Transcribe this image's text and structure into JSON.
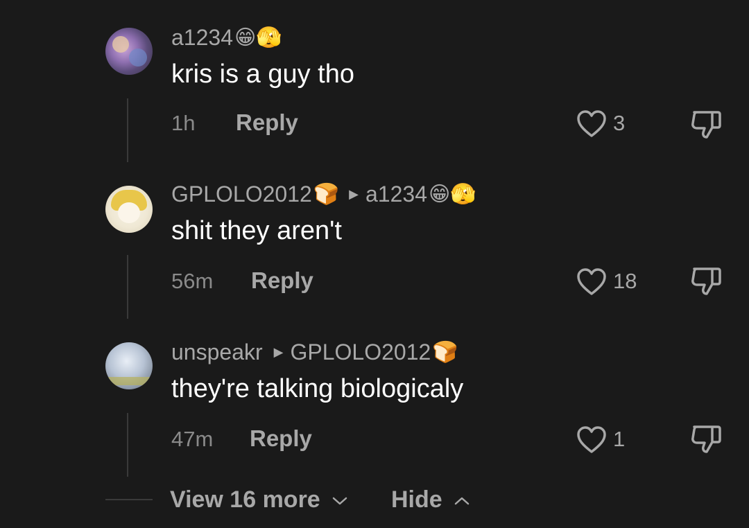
{
  "comments": [
    {
      "author": "a1234",
      "author_emoji": "😁🫣",
      "reply_to": "",
      "reply_to_emoji": "",
      "text": "kris is a guy tho",
      "time": "1h",
      "reply_label": "Reply",
      "likes": "3"
    },
    {
      "author": "GPLOLO2012",
      "author_emoji": "🍞",
      "reply_to": "a1234",
      "reply_to_emoji": "😁🫣",
      "text": "shit they aren't",
      "time": "56m",
      "reply_label": "Reply",
      "likes": "18"
    },
    {
      "author": "unspeakr",
      "author_emoji": "",
      "reply_to": "GPLOLO2012",
      "reply_to_emoji": "🍞",
      "text": "they're talking biologicaly",
      "time": "47m",
      "reply_label": "Reply",
      "likes": "1"
    }
  ],
  "footer": {
    "view_more": "View 16 more",
    "hide": "Hide"
  },
  "icons": {
    "heart": "heart-icon",
    "dislike": "thumbs-down-icon",
    "reply_arrow": "triangle-right-icon",
    "expand": "chevron-down-icon",
    "collapse": "chevron-up-icon"
  },
  "colors": {
    "background": "#1a1a1a",
    "primary_text": "#ffffff",
    "secondary_text": "#a8a8a8"
  }
}
